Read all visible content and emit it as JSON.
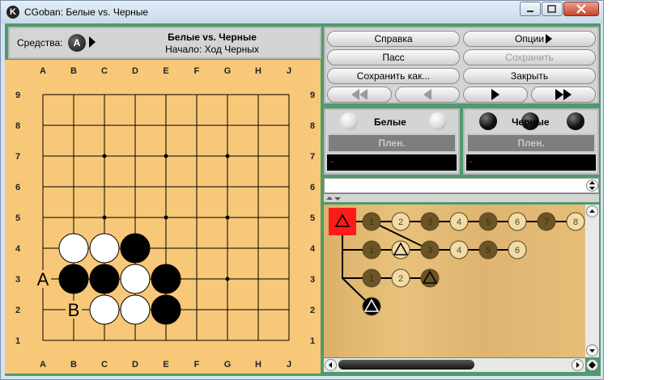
{
  "window": {
    "title": "CGoban: Белые vs. Черные",
    "icon": "cgoban-app-icon",
    "controls": [
      "minimize-icon",
      "maximize-icon",
      "close-icon"
    ]
  },
  "info": {
    "tools_label": "Средства:",
    "tool_letter": "A",
    "game_title": "Белые vs. Черные",
    "game_subtitle": "Начало: Ход Черных"
  },
  "buttons": {
    "help": "Справка",
    "options": "Опции",
    "pass": "Пасс",
    "save": "Сохранить",
    "save_as": "Сохранить как...",
    "close": "Закрыть"
  },
  "nav_icons": [
    "rewind-icon",
    "back-icon",
    "forward-icon",
    "fast-forward-icon"
  ],
  "players": {
    "white": {
      "name": "Белые",
      "captured": "Плен.",
      "clock": "-"
    },
    "black": {
      "name": "Черные",
      "captured": "Плен.",
      "clock": "-"
    }
  },
  "board": {
    "size": 9,
    "columns": [
      "A",
      "B",
      "C",
      "D",
      "E",
      "F",
      "G",
      "H",
      "J"
    ],
    "rows": [
      "9",
      "8",
      "7",
      "6",
      "5",
      "4",
      "3",
      "2",
      "1"
    ],
    "stones": [
      {
        "point": "B4",
        "color": "white"
      },
      {
        "point": "C4",
        "color": "white"
      },
      {
        "point": "D4",
        "color": "black"
      },
      {
        "point": "B3",
        "color": "black"
      },
      {
        "point": "C3",
        "color": "black"
      },
      {
        "point": "D3",
        "color": "white"
      },
      {
        "point": "E3",
        "color": "black"
      },
      {
        "point": "C2",
        "color": "white"
      },
      {
        "point": "D2",
        "color": "white"
      },
      {
        "point": "E2",
        "color": "black"
      }
    ],
    "labels": [
      {
        "point": "A3",
        "text": "A"
      },
      {
        "point": "B2",
        "text": "B"
      }
    ]
  },
  "tree": {
    "nodes": [
      {
        "label": "",
        "color": "black",
        "current": true,
        "marker": "triangle"
      },
      {
        "label": "1",
        "color": "black"
      },
      {
        "label": "2",
        "color": "white"
      },
      {
        "label": "3",
        "color": "black"
      },
      {
        "label": "4",
        "color": "white"
      },
      {
        "label": "5",
        "color": "black"
      },
      {
        "label": "6",
        "color": "white"
      },
      {
        "label": "7",
        "color": "black"
      },
      {
        "label": "8",
        "color": "white"
      },
      {
        "label": "1",
        "color": "black"
      },
      {
        "label": "",
        "color": "white",
        "marker": "triangle"
      },
      {
        "label": "3",
        "color": "black"
      },
      {
        "label": "4",
        "color": "white"
      },
      {
        "label": "5",
        "color": "black"
      },
      {
        "label": "6",
        "color": "white"
      },
      {
        "label": "1",
        "color": "black"
      },
      {
        "label": "2",
        "color": "white"
      },
      {
        "label": "",
        "color": "black",
        "marker": "triangle"
      },
      {
        "label": "",
        "color": "black",
        "marker": "triangle",
        "solid": true
      }
    ]
  },
  "comment": {
    "value": ""
  }
}
